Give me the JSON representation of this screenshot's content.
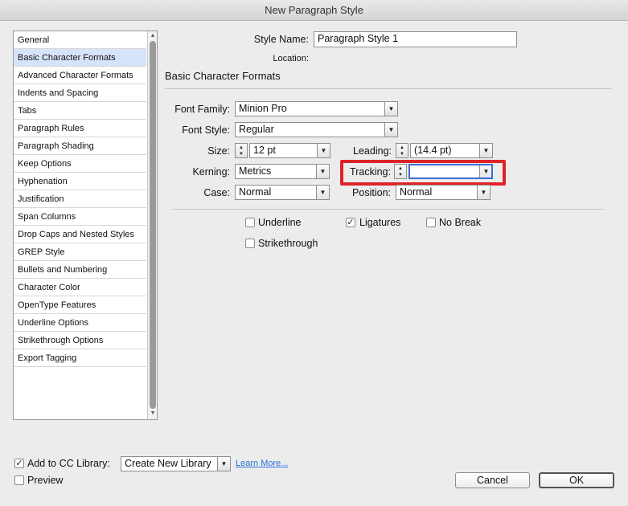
{
  "window": {
    "title": "New Paragraph Style"
  },
  "sidebar": {
    "items": [
      {
        "label": "General"
      },
      {
        "label": "Basic Character Formats"
      },
      {
        "label": "Advanced Character Formats"
      },
      {
        "label": "Indents and Spacing"
      },
      {
        "label": "Tabs"
      },
      {
        "label": "Paragraph Rules"
      },
      {
        "label": "Paragraph Shading"
      },
      {
        "label": "Keep Options"
      },
      {
        "label": "Hyphenation"
      },
      {
        "label": "Justification"
      },
      {
        "label": "Span Columns"
      },
      {
        "label": "Drop Caps and Nested Styles"
      },
      {
        "label": "GREP Style"
      },
      {
        "label": "Bullets and Numbering"
      },
      {
        "label": "Character Color"
      },
      {
        "label": "OpenType Features"
      },
      {
        "label": "Underline Options"
      },
      {
        "label": "Strikethrough Options"
      },
      {
        "label": "Export Tagging"
      }
    ],
    "selected": "Basic Character Formats"
  },
  "style_name": {
    "label": "Style Name:",
    "value": "Paragraph Style 1"
  },
  "location": {
    "label": "Location:"
  },
  "section_title": "Basic Character Formats",
  "fields": {
    "font_family": {
      "label": "Font Family:",
      "value": "Minion Pro"
    },
    "font_style": {
      "label": "Font Style:",
      "value": "Regular"
    },
    "size": {
      "label": "Size:",
      "value": "12 pt"
    },
    "leading": {
      "label": "Leading:",
      "value": "(14.4 pt)"
    },
    "kerning": {
      "label": "Kerning:",
      "value": "Metrics"
    },
    "tracking": {
      "label": "Tracking:",
      "value": ""
    },
    "case": {
      "label": "Case:",
      "value": "Normal"
    },
    "position": {
      "label": "Position:",
      "value": "Normal"
    }
  },
  "checkboxes": {
    "underline": {
      "label": "Underline",
      "checked": false
    },
    "ligatures": {
      "label": "Ligatures",
      "checked": true
    },
    "no_break": {
      "label": "No Break",
      "checked": false
    },
    "strikethrough": {
      "label": "Strikethrough",
      "checked": false
    }
  },
  "footer": {
    "add_to_cc_library": {
      "label": "Add to CC Library:",
      "checked": true
    },
    "library_select": "Create New Library",
    "learn_more": "Learn More...",
    "preview": {
      "label": "Preview",
      "checked": false
    },
    "cancel": "Cancel",
    "ok": "OK"
  },
  "colors": {
    "highlight": "#e0222a",
    "selection": "#d6e4fb",
    "link": "#2a6fdb",
    "focus": "#3b6fd6"
  }
}
